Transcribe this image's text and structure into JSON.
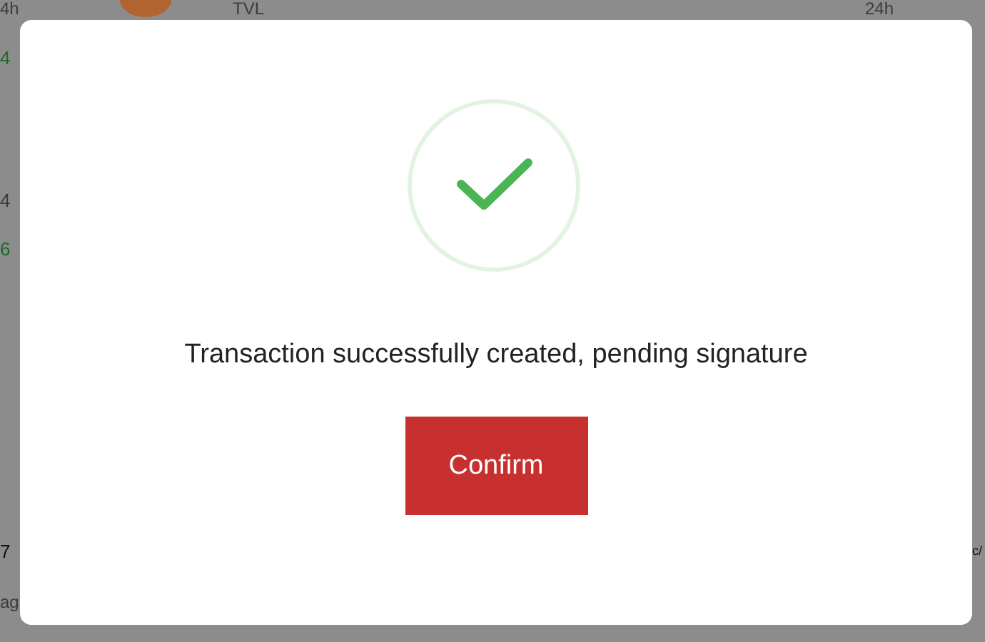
{
  "background": {
    "fragments": [
      {
        "text": "4h",
        "kind": "muted"
      },
      {
        "text": "TVL",
        "kind": "muted"
      },
      {
        "text": "24h",
        "kind": "muted"
      },
      {
        "text": "4",
        "kind": "green"
      },
      {
        "text": "4",
        "kind": "muted"
      },
      {
        "text": "6",
        "kind": "green"
      },
      {
        "text": "7",
        "kind": "dark"
      },
      {
        "text": "ag",
        "kind": "muted"
      },
      {
        "text": "c/",
        "kind": "dark"
      }
    ]
  },
  "dialog": {
    "message": "Transaction successfully created, pending signature",
    "button": "Confirm"
  }
}
